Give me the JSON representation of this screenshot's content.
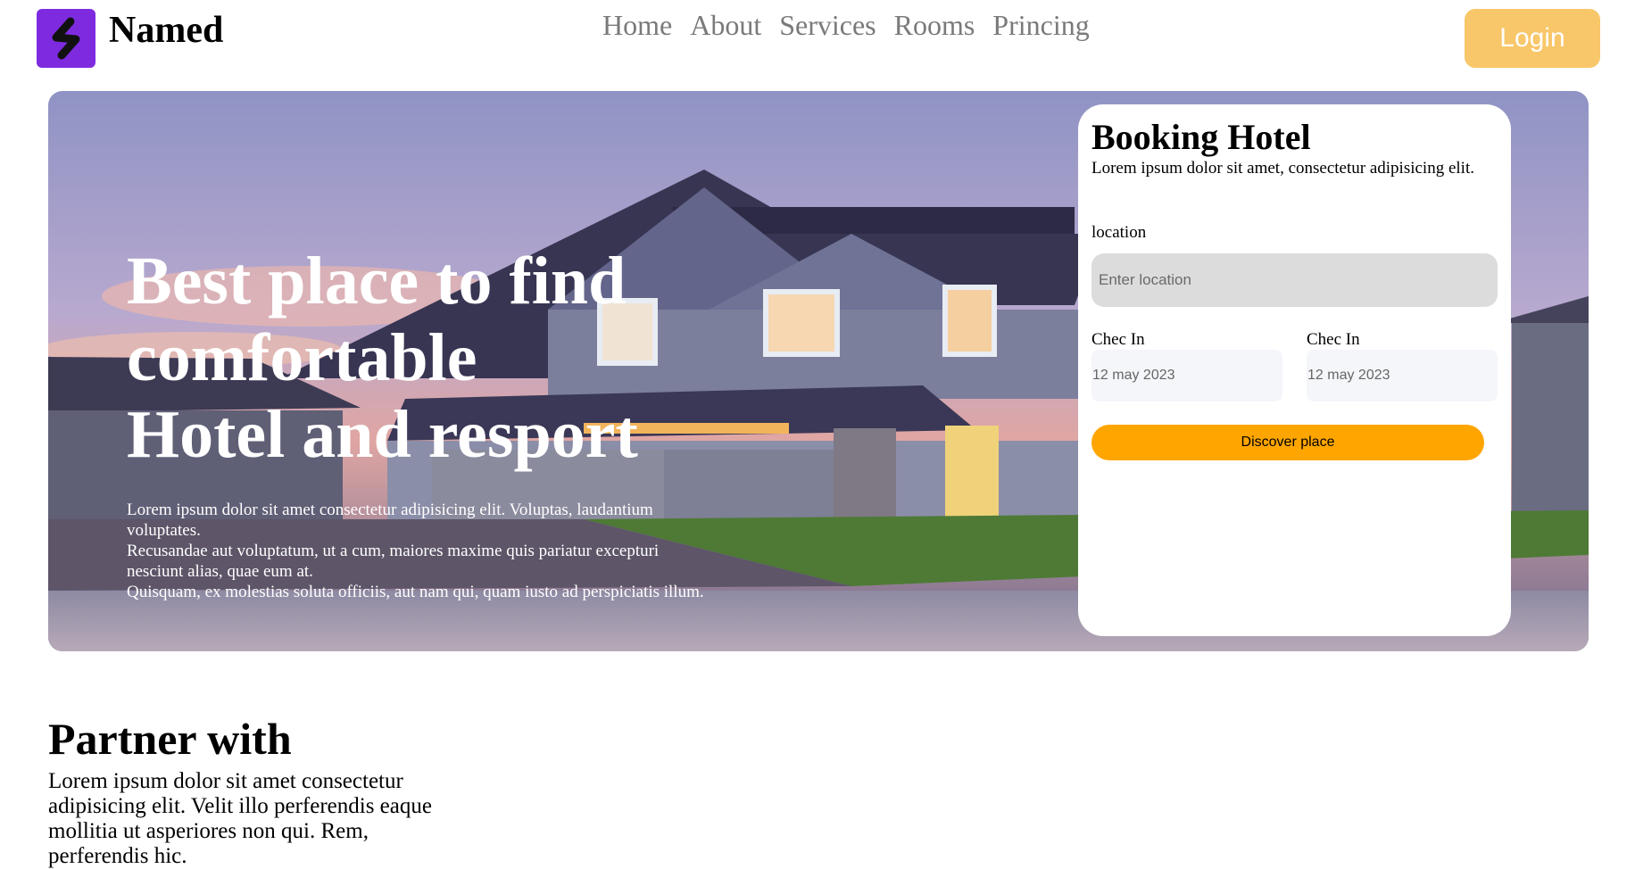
{
  "header": {
    "logo_icon": "brand-mark-icon",
    "brand": "Named",
    "nav": [
      "Home",
      "About",
      "Services",
      "Rooms",
      "Princing"
    ],
    "login_label": "Login"
  },
  "hero": {
    "title_lines": [
      "Best place to find",
      "comfortable",
      "Hotel and resport"
    ],
    "text_lines": [
      "Lorem ipsum dolor sit amet consectetur adipisicing elit. Voluptas, laudantium",
      "voluptates.",
      "Recusandae aut voluptatum, ut a cum, maiores maxime quis pariatur excepturi",
      "nesciunt alias, quae eum at.",
      "Quisquam, ex molestias soluta officiis, aut nam qui, quam iusto ad perspiciatis illum."
    ]
  },
  "booking": {
    "title": "Booking Hotel",
    "subtitle": "Lorem ipsum dolor sit amet, consectetur adipisicing elit.",
    "location_label": "location",
    "location_placeholder": "Enter location",
    "checkin_label_1": "Chec In",
    "checkin_value_1": "12 may 2023",
    "checkin_label_2": "Chec In",
    "checkin_value_2": "12 may 2023",
    "discover_label": "Discover place"
  },
  "partner": {
    "title": "Partner with",
    "text": "Lorem ipsum dolor sit amet consectetur adipisicing elit. Velit illo perferendis eaque mollitia ut asperiores non qui. Rem, perferendis hic."
  },
  "colors": {
    "accent": "#7e2be0",
    "login_bg": "#f8c76a",
    "discover_bg": "#ffa500"
  }
}
